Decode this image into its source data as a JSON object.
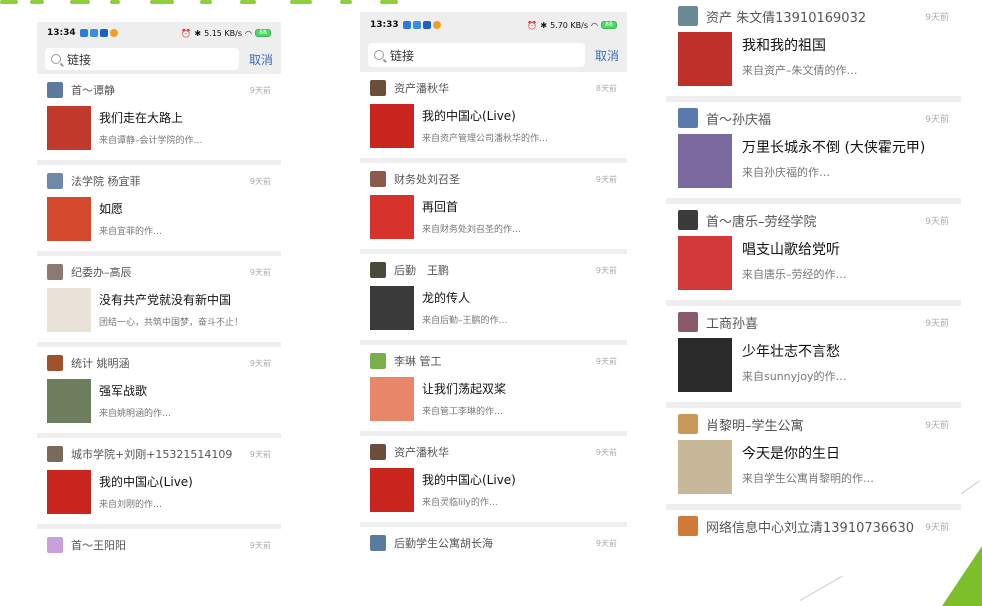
{
  "colors": {
    "accent": "#8fcf3c",
    "separator": "#eeeeee",
    "cancel": "#3a6fb0"
  },
  "left": {
    "status_time": "13:34",
    "status_right": "5.15 KB/s",
    "battery": "88",
    "search_value": "链接",
    "cancel_label": "取消",
    "items": [
      {
        "sender": "首～谭静",
        "date": "9天前",
        "title": "我们走在大路上",
        "sub": "来自谭静–会计学院的作…",
        "thumb_color": "#c0392b",
        "avatar_color": "#5d7a9c"
      },
      {
        "sender": "法学院 杨宜菲",
        "date": "9天前",
        "title": "如愿",
        "sub": "来自宜菲的作…",
        "thumb_color": "#d4482c",
        "avatar_color": "#6f8aa8"
      },
      {
        "sender": "纪委办–高辰",
        "date": "9天前",
        "title": "没有共产党就没有新中国",
        "sub": "团结一心，共筑中国梦，奋斗不止！",
        "thumb_color": "#e8e2d8",
        "avatar_color": "#8a7a72"
      },
      {
        "sender": "统计 姚明涵",
        "date": "9天前",
        "title": "强军战歌",
        "sub": "来自姚明涵的作…",
        "thumb_color": "#6e7d5e",
        "avatar_color": "#a0522d"
      },
      {
        "sender": "城市学院+刘刚+15321514109",
        "date": "9天前",
        "title": "我的中国心(Live)",
        "sub": "来自刘刚的作…",
        "thumb_color": "#c8261e",
        "avatar_color": "#7a6a5a"
      },
      {
        "sender": "首～王阳阳",
        "date": "9天前",
        "title": "",
        "sub": "",
        "thumb_color": "#ffffff",
        "avatar_color": "#c9a0dc"
      }
    ]
  },
  "middle": {
    "status_time": "13:33",
    "status_right": "5.70 KB/s",
    "battery": "88",
    "search_value": "链接",
    "cancel_label": "取消",
    "items": [
      {
        "sender": "资产潘秋华",
        "date": "8天前",
        "title": "我的中国心(Live)",
        "sub": "来自资产管理公司潘秋华的作…",
        "thumb_color": "#c8261e",
        "avatar_color": "#6b4e3a"
      },
      {
        "sender": "财务处刘召圣",
        "date": "9天前",
        "title": "再回首",
        "sub": "来自财务处刘召圣的作…",
        "thumb_color": "#d8322c",
        "avatar_color": "#8a5a4a"
      },
      {
        "sender": "后勤　王鹏",
        "date": "9天前",
        "title": "龙的传人",
        "sub": "来自后勤–王鹏的作…",
        "thumb_color": "#3a3a3a",
        "avatar_color": "#4a4a3a"
      },
      {
        "sender": "李琳 管工",
        "date": "9天前",
        "title": "让我们荡起双桨",
        "sub": "来自管工李琳的作…",
        "thumb_color": "#e8866a",
        "avatar_color": "#7ab04a"
      },
      {
        "sender": "资产潘秋华",
        "date": "9天前",
        "title": "我的中国心(Live)",
        "sub": "来自灵临lily的作…",
        "thumb_color": "#c8261e",
        "avatar_color": "#6b4e3a"
      },
      {
        "sender": "后勤学生公寓胡长海",
        "date": "9天前",
        "title": "",
        "sub": "",
        "thumb_color": "#ffffff",
        "avatar_color": "#5a7aa0"
      }
    ]
  },
  "right": {
    "items": [
      {
        "sender": "资产 朱文倩13910169032",
        "date": "9天前",
        "title": "我和我的祖国",
        "sub": "来自资产–朱文倩的作…",
        "thumb_color": "#c0302a",
        "avatar_color": "#6a8a9a"
      },
      {
        "sender": "首～孙庆福",
        "date": "9天前",
        "title": "万里长城永不倒 (大侠霍元甲)",
        "sub": "来自孙庆福的作…",
        "thumb_color": "#7a6aa0",
        "avatar_color": "#5a7ab0"
      },
      {
        "sender": "首～唐乐–劳经学院",
        "date": "9天前",
        "title": "唱支山歌给党听",
        "sub": "来自唐乐–劳经的作…",
        "thumb_color": "#d23a3a",
        "avatar_color": "#3a3a3a"
      },
      {
        "sender": "工商孙喜",
        "date": "9天前",
        "title": "少年壮志不言愁",
        "sub": "来自sunnyjoy的作…",
        "thumb_color": "#2a2a2a",
        "avatar_color": "#8a5a6a"
      },
      {
        "sender": "肖黎明–学生公寓",
        "date": "9天前",
        "title": "今天是你的生日",
        "sub": "来自学生公寓肖黎明的作…",
        "thumb_color": "#c8b89a",
        "avatar_color": "#c89a5a"
      },
      {
        "sender": "网络信息中心刘立清13910736630",
        "date": "9天前",
        "title": "",
        "sub": "",
        "thumb_color": "#ffffff",
        "avatar_color": "#d07a3a"
      }
    ]
  }
}
